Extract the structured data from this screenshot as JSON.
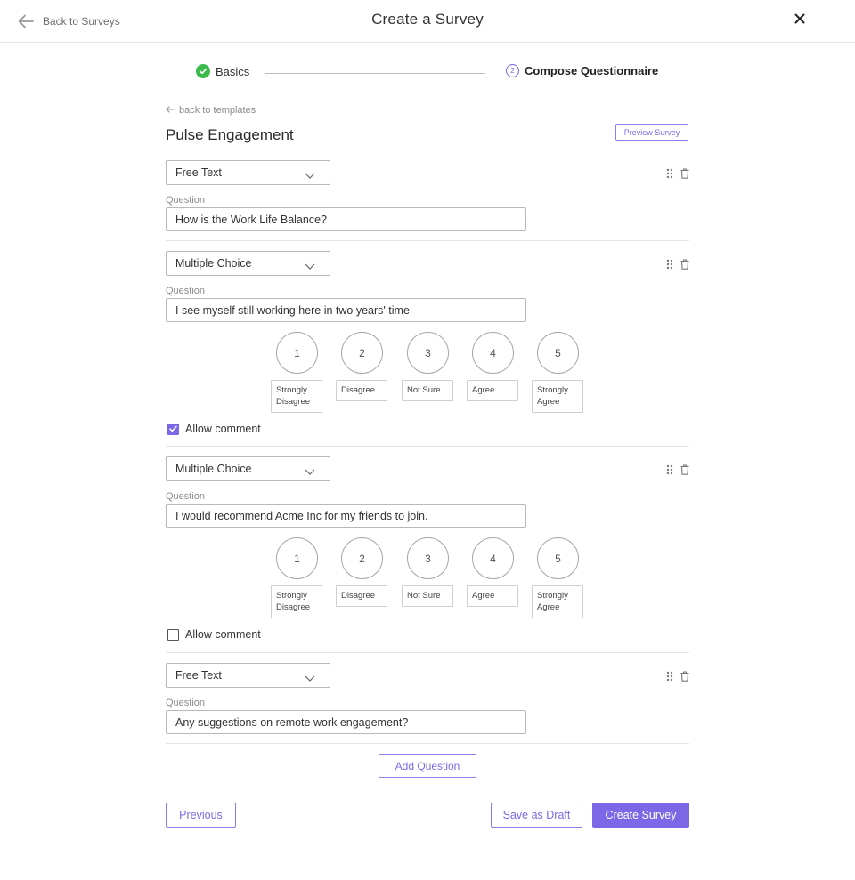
{
  "header": {
    "back_label": "Back to Surveys",
    "title": "Create a Survey"
  },
  "stepper": {
    "step1_label": "Basics",
    "step2_number": "2",
    "step2_label": "Compose Questionnaire"
  },
  "template": {
    "back_label": "back to templates",
    "name": "Pulse Engagement",
    "preview_label": "Preview Survey"
  },
  "question_label": "Question",
  "allow_comment_label": "Allow comment",
  "scale": {
    "numbers": [
      "1",
      "2",
      "3",
      "4",
      "5"
    ],
    "labels": [
      "Strongly Disagree",
      "Disagree",
      "Not Sure",
      "Agree",
      "Strongly Agree"
    ]
  },
  "questions": [
    {
      "type": "Free Text",
      "text": "How is the Work Life Balance?"
    },
    {
      "type": "Multiple Choice",
      "text": "I see myself still working here in two years' time",
      "allow_comment": true
    },
    {
      "type": "Multiple Choice",
      "text": "I would recommend Acme Inc for my friends to join.",
      "allow_comment": false
    },
    {
      "type": "Free Text",
      "text": "Any suggestions on remote work engagement?"
    }
  ],
  "footer": {
    "add_question": "Add Question",
    "previous": "Previous",
    "save_draft": "Save as Draft",
    "create": "Create Survey"
  },
  "colors": {
    "accent": "#7c68e6",
    "success": "#3dbb4c"
  },
  "icons": {
    "back": "arrow-left-icon",
    "close": "close-icon",
    "check": "check-circle-icon",
    "chevron": "chevron-down-icon",
    "drag": "drag-handle-icon",
    "delete": "trash-icon"
  }
}
